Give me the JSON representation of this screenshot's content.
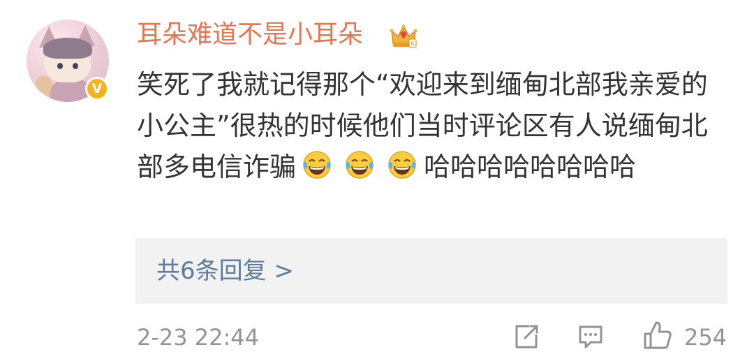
{
  "comment": {
    "username": "耳朵难道不是小耳朵",
    "badge_icon": "crown-icon",
    "verified_icon": "verified-badge-icon",
    "verified_mark": "V",
    "text_parts": {
      "before_emoji": "笑死了我就记得那个“欢迎来到缅甸北部我亲爱的小公主”很热的时候他们当时评论区有人说缅甸北部多电信诈骗",
      "emoji": [
        "laughing-tears-emoji",
        "laughing-tears-emoji",
        "laughing-tears-emoji"
      ],
      "after_emoji": "哈哈哈哈哈哈哈哈"
    },
    "reply_link": "共6条回复 >",
    "timestamp": "2-23 22:44",
    "actions": {
      "share_icon": "share-icon",
      "comment_icon": "comment-icon",
      "like_icon": "like-icon",
      "like_count": "254"
    }
  },
  "colors": {
    "username": "#eb7350",
    "body_text": "#333333",
    "link": "#5d7c9b",
    "meta": "#939393",
    "reply_bg": "#f2f2f2",
    "verified": "#f6b21b"
  }
}
